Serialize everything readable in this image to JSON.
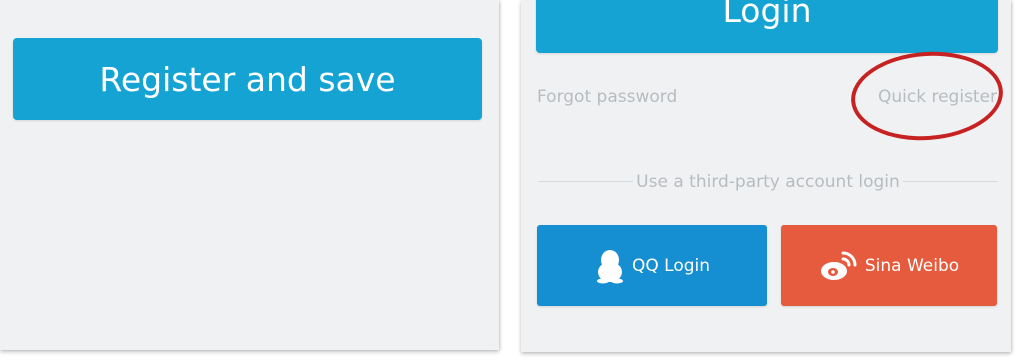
{
  "register_panel": {
    "register_button_label": "Register and save"
  },
  "login_panel": {
    "login_button_label": "Login",
    "forgot_password_label": "Forgot password",
    "quick_register_label": "Quick register",
    "third_party_divider_text": "Use a third-party account login",
    "qq_login_label": "QQ Login",
    "sina_weibo_label": "Sina Weibo",
    "qq_icon": "qq-penguin-icon",
    "weibo_icon": "weibo-icon"
  },
  "colors": {
    "primary_blue": "#14a3d2",
    "qq_blue": "#168ed2",
    "weibo_orange": "#e65a3d",
    "annotation_red": "#c62222",
    "panel_background": "#f0f1f2",
    "muted_text": "#b7bcc1"
  }
}
